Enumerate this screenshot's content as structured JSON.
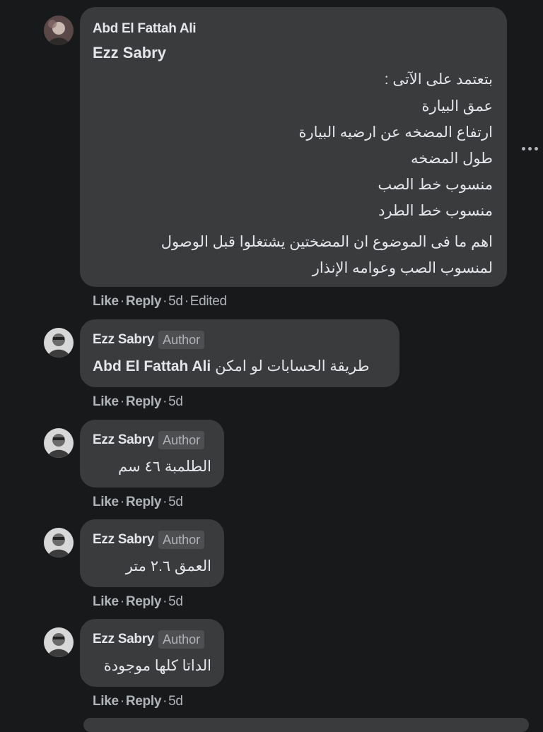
{
  "comments": [
    {
      "author": "Abd El Fattah Ali",
      "mention": "Ezz Sabry",
      "lines": [
        "بتعتمد على الآتى :",
        "عمق البيارة",
        "ارتفاع المضخه عن ارضيه البيارة",
        "طول المضخه",
        "منسوب خط الصب",
        "منسوب خط الطرد"
      ],
      "paragraph": [
        "اهم ما فى الموضوع ان المضختين يشتغلوا قبل الوصول",
        "لمنسوب الصب وعوامه الإنذار"
      ],
      "like": "Like",
      "reply": "Reply",
      "time": "5d",
      "edited": "Edited"
    },
    {
      "author": "Ezz Sabry",
      "badge": "Author",
      "mention": "Abd El Fattah Ali",
      "text": "طريقة الحسابات لو امكن",
      "like": "Like",
      "reply": "Reply",
      "time": "5d"
    },
    {
      "author": "Ezz Sabry",
      "badge": "Author",
      "text": "الطلمبة ٤٦ سم",
      "like": "Like",
      "reply": "Reply",
      "time": "5d"
    },
    {
      "author": "Ezz Sabry",
      "badge": "Author",
      "text": "العمق ٢.٦ متر",
      "like": "Like",
      "reply": "Reply",
      "time": "5d"
    },
    {
      "author": "Ezz Sabry",
      "badge": "Author",
      "text": "الداتا كلها موجودة",
      "like": "Like",
      "reply": "Reply",
      "time": "5d"
    }
  ],
  "icons": {
    "more": "more-options-icon",
    "avatar_first": "profile-photo",
    "avatar_rest": "profile-photo"
  },
  "colors": {
    "background": "#18191a",
    "bubble": "#3a3b3c",
    "text": "#e4e6eb",
    "secondary_text": "#b0b3b8",
    "badge_bg": "#4e4f50"
  }
}
